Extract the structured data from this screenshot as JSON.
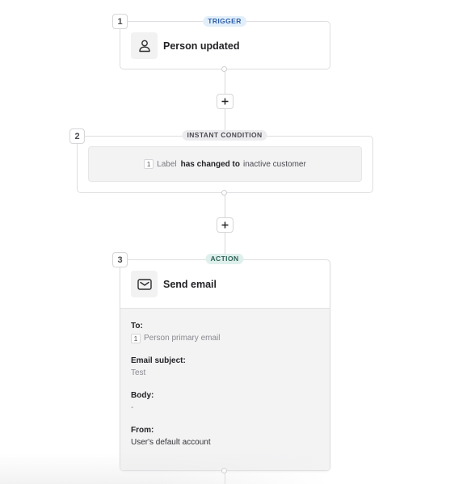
{
  "workflow": {
    "steps": [
      {
        "number": "1",
        "badge": "TRIGGER",
        "icon": "person-icon",
        "title": "Person updated"
      },
      {
        "number": "2",
        "badge": "INSTANT CONDITION",
        "condition": {
          "ref_step": "1",
          "field": "Label",
          "operator": "has changed to",
          "value": "inactive customer"
        }
      },
      {
        "number": "3",
        "badge": "ACTION",
        "icon": "envelope-icon",
        "title": "Send email",
        "fields": [
          {
            "label": "To:",
            "ref_step": "1",
            "value": "Person primary email"
          },
          {
            "label": "Email subject:",
            "value": "Test"
          },
          {
            "label": "Body:",
            "value": "-"
          },
          {
            "label": "From:",
            "value": "User's default account"
          }
        ]
      }
    ],
    "add_step_icon": "plus-icon"
  },
  "colors": {
    "trigger_badge_bg": "#e2effa",
    "trigger_badge_text": "#2f5ea8",
    "condition_badge_bg": "#ececee",
    "action_badge_bg": "#dff0ec",
    "action_badge_text": "#2f6357"
  }
}
